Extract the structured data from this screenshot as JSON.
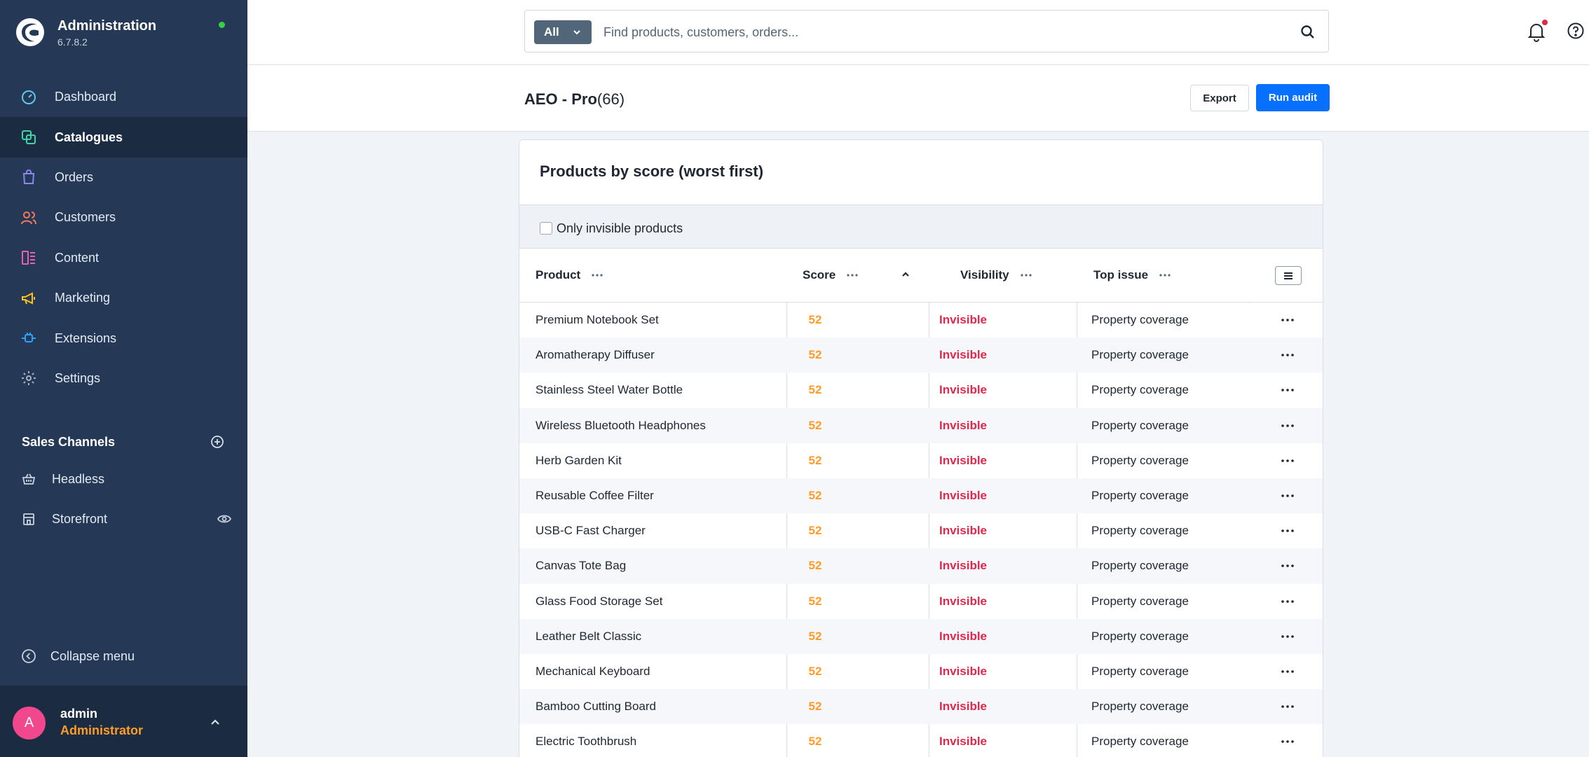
{
  "app": {
    "title": "Administration",
    "version": "6.7.8.2",
    "logo_icon": "shopware-logo-icon",
    "status_color": "#37d046"
  },
  "sidebar": {
    "items": [
      {
        "label": "Dashboard",
        "icon": "dashboard-icon",
        "active": false
      },
      {
        "label": "Catalogues",
        "icon": "catalogues-icon",
        "active": true
      },
      {
        "label": "Orders",
        "icon": "shopping-bag-icon",
        "active": false
      },
      {
        "label": "Customers",
        "icon": "users-icon",
        "active": false
      },
      {
        "label": "Content",
        "icon": "content-icon",
        "active": false
      },
      {
        "label": "Marketing",
        "icon": "megaphone-icon",
        "active": false
      },
      {
        "label": "Extensions",
        "icon": "plug-icon",
        "active": false
      },
      {
        "label": "Settings",
        "icon": "gear-icon",
        "active": false
      }
    ],
    "sales_channels": {
      "title": "Sales Channels",
      "items": [
        {
          "label": "Headless",
          "icon": "basket-icon"
        },
        {
          "label": "Storefront",
          "icon": "storefront-icon",
          "trailing_icon": "eye-icon"
        }
      ]
    },
    "collapse_label": "Collapse menu",
    "user": {
      "initial": "A",
      "name": "admin",
      "role": "Administrator"
    }
  },
  "search": {
    "type_label": "All",
    "placeholder": "Find products, customers, orders..."
  },
  "header": {
    "title": "AEO - Pro",
    "count": "(66)",
    "export_label": "Export",
    "run_label": "Run audit"
  },
  "card": {
    "title": "Products by score (worst first)",
    "filter_label": "Only invisible products"
  },
  "table": {
    "columns": [
      "Product",
      "Score",
      "Visibility",
      "Top issue"
    ],
    "rows": [
      {
        "product": "Premium Notebook Set",
        "score": "52",
        "visibility": "Invisible",
        "issue": "Property coverage"
      },
      {
        "product": "Aromatherapy Diffuser",
        "score": "52",
        "visibility": "Invisible",
        "issue": "Property coverage"
      },
      {
        "product": "Stainless Steel Water Bottle",
        "score": "52",
        "visibility": "Invisible",
        "issue": "Property coverage"
      },
      {
        "product": "Wireless Bluetooth Headphones",
        "score": "52",
        "visibility": "Invisible",
        "issue": "Property coverage"
      },
      {
        "product": "Herb Garden Kit",
        "score": "52",
        "visibility": "Invisible",
        "issue": "Property coverage"
      },
      {
        "product": "Reusable Coffee Filter",
        "score": "52",
        "visibility": "Invisible",
        "issue": "Property coverage"
      },
      {
        "product": "USB-C Fast Charger",
        "score": "52",
        "visibility": "Invisible",
        "issue": "Property coverage"
      },
      {
        "product": "Canvas Tote Bag",
        "score": "52",
        "visibility": "Invisible",
        "issue": "Property coverage"
      },
      {
        "product": "Glass Food Storage Set",
        "score": "52",
        "visibility": "Invisible",
        "issue": "Property coverage"
      },
      {
        "product": "Leather Belt Classic",
        "score": "52",
        "visibility": "Invisible",
        "issue": "Property coverage"
      },
      {
        "product": "Mechanical Keyboard",
        "score": "52",
        "visibility": "Invisible",
        "issue": "Property coverage"
      },
      {
        "product": "Bamboo Cutting Board",
        "score": "52",
        "visibility": "Invisible",
        "issue": "Property coverage"
      },
      {
        "product": "Electric Toothbrush",
        "score": "52",
        "visibility": "Invisible",
        "issue": "Property coverage"
      }
    ]
  },
  "colors": {
    "sidebar_bg": "#253855",
    "sidebar_active": "#1b2b42",
    "primary": "#0870ff",
    "score": "#ff9c28",
    "invisible": "#de294c",
    "avatar": "#f0478d"
  }
}
